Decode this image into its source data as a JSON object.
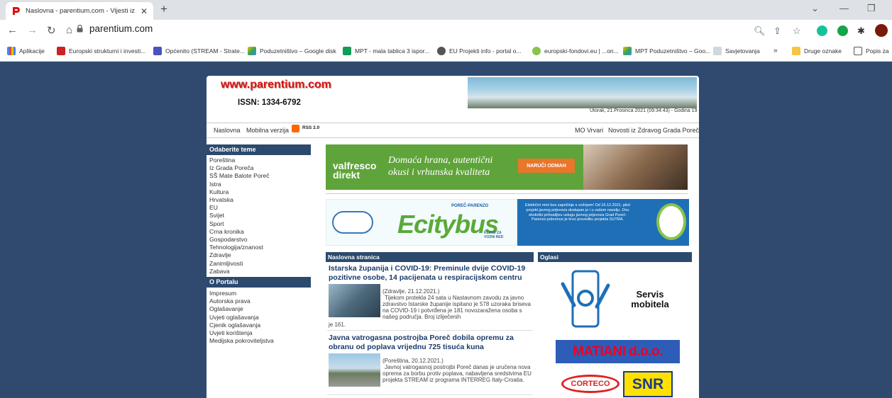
{
  "browser": {
    "tab_title": "Naslovna - parentium.com - Vijesti iz Poreča",
    "url": "parentium.com",
    "bookmarks": [
      "Aplikacije",
      "Europski strukturni i investi...",
      "Općenito (STREAM - Strate...",
      "Poduzetništvo – Google disk",
      "MPT - mala tablica 3 ispor...",
      "EU Projekti info - portal o...",
      "europski-fondovi.eu | ...on...",
      "MPT Poduzetništvo – Goo...",
      "Savjetovanja",
      "»",
      "Druge oznake",
      "Popis za"
    ]
  },
  "site": {
    "logo": "www.parentium.com",
    "issn": "ISSN: 1334-6792",
    "dateline": "Utorak, 21.Prosinca 2021 (09:34:43) - Godina 19",
    "nav_left": [
      "Naslovna",
      "Mobilna verzija"
    ],
    "rss_label": "RSS 2.0",
    "nav_right": [
      "MO Vrvari",
      "Novosti iz Zdravog Grada Poreč"
    ]
  },
  "sidebar": {
    "topics_heading": "Odaberite teme",
    "topics": [
      "Poreština",
      "Iz Grada Poreča",
      "SŠ Mate Balote Poreč",
      "Istra",
      "Kultura",
      "Hrvatska",
      "EU",
      "Svijet",
      "Sport",
      "Crna kronika",
      "Gospodarstvo",
      "Tehnologija/znanost",
      "Zdravlje",
      "Zanimljivosti",
      "Zabava"
    ],
    "portal_heading": "O Portalu",
    "portal_items": [
      "Impresum",
      "Autorska prava",
      "Oglašavanje",
      "Uvjeti oglašavanja",
      "Cjenik oglašavanja",
      "Uvjeti korištenja",
      "Medijska pokroviteljstva"
    ]
  },
  "ads": {
    "valfresco_brand": "valfresco direkt",
    "valfresco_slogan": "Domaća hrana, autentični okusi i vrhunska kvaliteta",
    "valfresco_button": "NARUČI ODMAH",
    "citybus_tag": "POREČ-PARENZO",
    "citybus_name": "Ecitybus",
    "citybus_cta": "KLIKNI ZA VOZNI RED",
    "citybus_info": "Električni mini bus započinje s vožnjom! Od 16.12.2021. pilot projekt javnog prijevoza dostupan je i u vašem naselju. Ovu ekološki prihvatljivu uslugu javnog prijevoza Grad Poreč-Parenzo pokrenuo je kroz provedbu projekta SUTRA."
  },
  "main": {
    "section_heading": "Naslovna stranica",
    "articles": [
      {
        "title": "Istarska županija i COVID-19: Preminule dvije COVID-19 pozitivne osobe, 14 pacijenata u respiracijskom centru",
        "meta": "(Zdravlje, 21.12.2021.)",
        "body": "Tijekom protekla 24 sata u Nastavnom zavodu za javno zdravstvo Istarske županije ispitano je 578 uzoraka briseva na COVID-19 i potvrđena je 181 novozaražena osoba s našeg područja. Broj izliječenih",
        "tail": "je 161."
      },
      {
        "title": "Javna vatrogasna postrojba Poreč dobila opremu za obranu od poplava vrijednu 725 tisuća kuna",
        "meta": "(Poreština, 20.12.2021.)",
        "body": "Javnoj vatrogasnoj postrojbi Poreč danas je uručena nova oprema za borbu protiv poplava, nabavljena sredstvima EU projekta STREAM iz programa INTERREG Italy-Croatia."
      }
    ]
  },
  "oglasi": {
    "heading": "Oglasi",
    "servis": "Servis mobitela",
    "matiani": "MATIANI d.o.o.",
    "corteco": "CORTECO",
    "snr": "SNR"
  }
}
